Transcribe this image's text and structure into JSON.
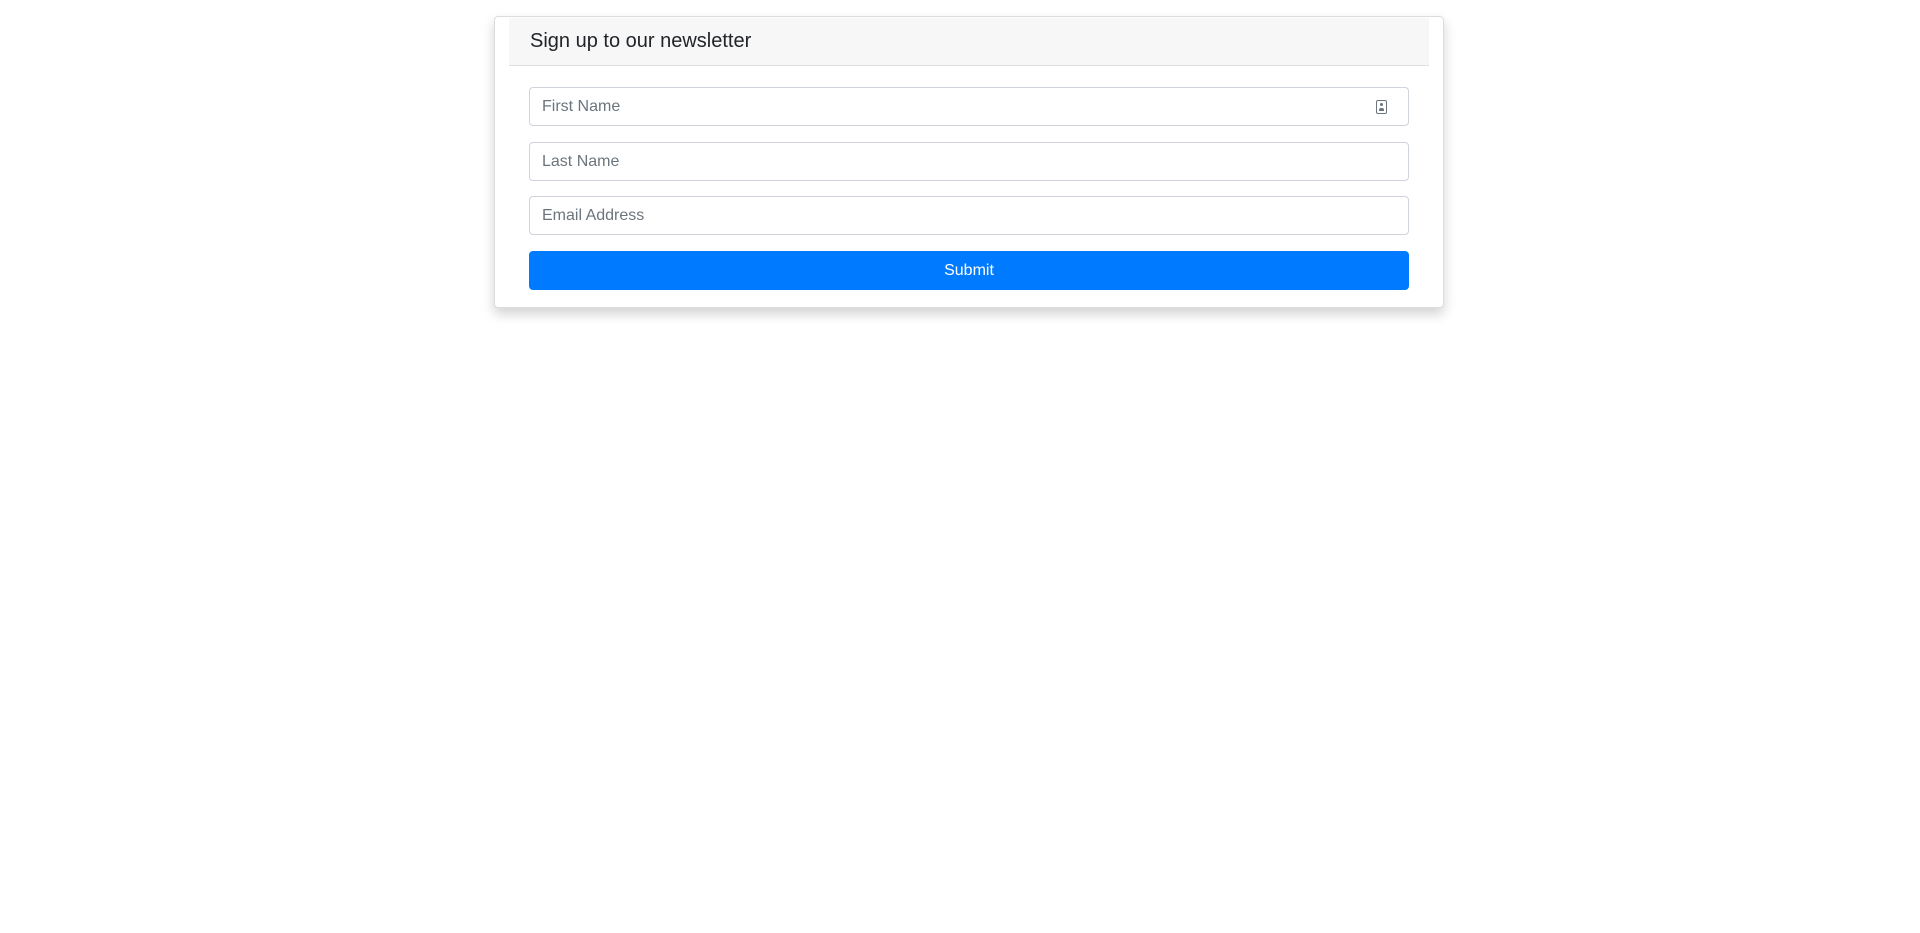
{
  "card": {
    "title": "Sign up to our newsletter"
  },
  "form": {
    "first_name": {
      "value": "",
      "placeholder": "First Name",
      "icon": "contact-card-icon"
    },
    "last_name": {
      "value": "",
      "placeholder": "Last Name"
    },
    "email": {
      "value": "",
      "placeholder": "Email Address"
    },
    "submit_label": "Submit"
  },
  "colors": {
    "accent": "#007bff",
    "header_background": "#f7f7f7",
    "input_border": "#ced4da",
    "placeholder": "#6c757d"
  }
}
